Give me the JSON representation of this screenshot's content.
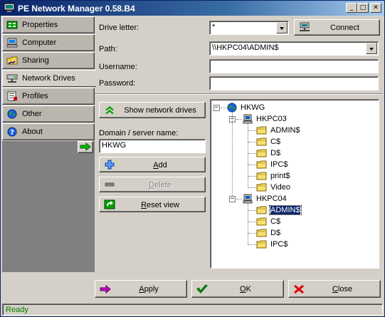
{
  "window": {
    "title": "PE Network Manager 0.58.B4",
    "controls": {
      "minimize": "_",
      "maximize": "□",
      "close": "✕"
    }
  },
  "sidebar": {
    "items": [
      {
        "label": "Properties",
        "icon": "properties-icon"
      },
      {
        "label": "Computer",
        "icon": "computer-icon"
      },
      {
        "label": "Sharing",
        "icon": "sharing-icon"
      },
      {
        "label": "Network Drives",
        "icon": "network-drive-icon",
        "active": true
      },
      {
        "label": "Profiles",
        "icon": "profiles-icon"
      },
      {
        "label": "Other",
        "icon": "globe-icon"
      },
      {
        "label": "About",
        "icon": "help-icon"
      }
    ]
  },
  "form": {
    "drive_letter_label": "Drive letter:",
    "drive_letter_value": "*",
    "connect_label": "Connect",
    "path_label": "Path:",
    "path_value": "\\\\HKPC04\\ADMIN$",
    "username_label": "Username:",
    "username_value": "",
    "password_label": "Password:",
    "password_value": ""
  },
  "actions": {
    "show_network_drives": "Show network drives",
    "domain_label": "Domain / server name:",
    "domain_value": "HKWG",
    "add": "Add",
    "delete": "Delete",
    "reset_view": "Reset view"
  },
  "tree": {
    "root": "HKWG",
    "hosts": [
      {
        "name": "HKPC03",
        "shares": [
          "ADMIN$",
          "C$",
          "D$",
          "IPC$",
          "print$",
          "Video"
        ]
      },
      {
        "name": "HKPC04",
        "shares": [
          "ADMIN$",
          "C$",
          "D$",
          "IPC$"
        ]
      }
    ],
    "expander_expanded": "−",
    "selected": "HKPC04/ADMIN$"
  },
  "footer": {
    "apply": "Apply",
    "ok": "OK",
    "close": "Close"
  },
  "status": {
    "text": "Ready"
  },
  "colors": {
    "titlebar_start": "#0a246a",
    "titlebar_end": "#a6caf0",
    "face": "#d4d0c8",
    "status_text": "#008000",
    "selection": "#0a246a"
  }
}
